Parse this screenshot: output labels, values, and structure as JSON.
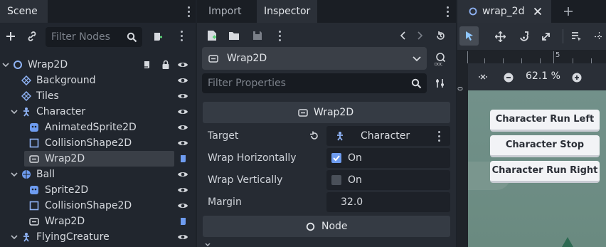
{
  "scene_panel": {
    "tab_label": "Scene",
    "filter_placeholder": "Filter Nodes",
    "tree": [
      {
        "label": "Wrap2D",
        "icon": "node2d-circle-icon"
      },
      {
        "label": "Background",
        "icon": "tilemap-icon"
      },
      {
        "label": "Tiles",
        "icon": "tilemap-icon"
      },
      {
        "label": "Character",
        "icon": "character-icon"
      },
      {
        "label": "AnimatedSprite2D",
        "icon": "animated-sprite-icon"
      },
      {
        "label": "CollisionShape2D",
        "icon": "collision-shape-icon"
      },
      {
        "label": "Wrap2D",
        "icon": "wrap2d-icon"
      },
      {
        "label": "Ball",
        "icon": "rigidbody-icon"
      },
      {
        "label": "Sprite2D",
        "icon": "sprite-icon"
      },
      {
        "label": "CollisionShape2D",
        "icon": "collision-shape-icon"
      },
      {
        "label": "Wrap2D",
        "icon": "wrap2d-icon"
      },
      {
        "label": "FlyingCreature",
        "icon": "character-icon"
      }
    ]
  },
  "inspector_panel": {
    "tabs": [
      "Import",
      "Inspector"
    ],
    "resource_name": "Wrap2D",
    "filter_placeholder": "Filter Properties",
    "section_title": "Wrap2D",
    "properties": [
      {
        "name": "Target",
        "value": "Character"
      },
      {
        "name": "Wrap Horizontally",
        "value": "On",
        "checked": true
      },
      {
        "name": "Wrap Vertically",
        "value": "On",
        "checked": false
      },
      {
        "name": "Margin",
        "value": "32.0"
      }
    ],
    "node_section_title": "Node"
  },
  "viewport_panel": {
    "tab_label": "wrap_2d",
    "zoom_level": "62.1 %",
    "ruler_number": "5",
    "ruler_side_number": "0",
    "game_buttons": [
      "Character Run Left",
      "Character Stop",
      "Character Run Right"
    ],
    "colors": {
      "game_background": "#6f8e84",
      "button_face": "#f2f3f6",
      "node_icon_blue": "#6e9cf0"
    }
  }
}
